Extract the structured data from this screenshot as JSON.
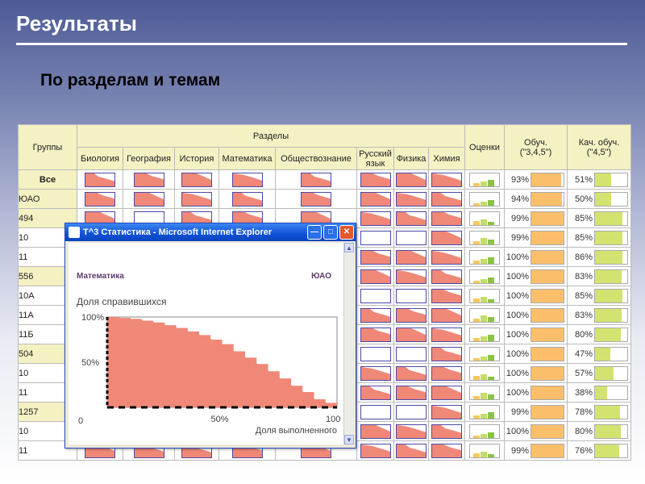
{
  "slide": {
    "title": "Результаты",
    "subtitle": "По разделам и темам"
  },
  "table": {
    "header_groups": "Группы",
    "header_sections": "Разделы",
    "header_grades": "Оценки",
    "header_obuch": "Обуч. (\"3,4,5\")",
    "header_kach": "Кач. обуч. (\"4,5\")",
    "subjects": [
      "Биология",
      "География",
      "История",
      "Математика",
      "Обществознание",
      "Русский язык",
      "Физика",
      "Химия"
    ],
    "rows": [
      {
        "group": "Все",
        "level": 0,
        "obuch": "93%",
        "obuch_value": 0.93,
        "kach": "51%",
        "kach_value": 0.51
      },
      {
        "group": "ЮАО",
        "level": 1,
        "obuch": "94%",
        "obuch_value": 0.94,
        "kach": "50%",
        "kach_value": 0.5
      },
      {
        "group": "494",
        "level": 2,
        "obuch": "99%",
        "obuch_value": 0.99,
        "kach": "85%",
        "kach_value": 0.85
      },
      {
        "group": "10",
        "level": 3,
        "obuch": "99%",
        "obuch_value": 0.99,
        "kach": "85%",
        "kach_value": 0.85
      },
      {
        "group": "11",
        "level": 3,
        "obuch": "100%",
        "obuch_value": 1.0,
        "kach": "86%",
        "kach_value": 0.86
      },
      {
        "group": "556",
        "level": 2,
        "obuch": "100%",
        "obuch_value": 1.0,
        "kach": "83%",
        "kach_value": 0.83
      },
      {
        "group": "10А",
        "level": 3,
        "obuch": "100%",
        "obuch_value": 1.0,
        "kach": "85%",
        "kach_value": 0.85
      },
      {
        "group": "11А",
        "level": 3,
        "obuch": "100%",
        "obuch_value": 1.0,
        "kach": "83%",
        "kach_value": 0.83
      },
      {
        "group": "11Б",
        "level": 3,
        "obuch": "100%",
        "obuch_value": 1.0,
        "kach": "80%",
        "kach_value": 0.8
      },
      {
        "group": "504",
        "level": 2,
        "obuch": "100%",
        "obuch_value": 1.0,
        "kach": "47%",
        "kach_value": 0.47
      },
      {
        "group": "10",
        "level": 3,
        "obuch": "100%",
        "obuch_value": 1.0,
        "kach": "57%",
        "kach_value": 0.57
      },
      {
        "group": "11",
        "level": 3,
        "obuch": "100%",
        "obuch_value": 1.0,
        "kach": "38%",
        "kach_value": 0.38
      },
      {
        "group": "1257",
        "level": 2,
        "obuch": "99%",
        "obuch_value": 0.99,
        "kach": "78%",
        "kach_value": 0.78
      },
      {
        "group": "10",
        "level": 3,
        "obuch": "100%",
        "obuch_value": 1.0,
        "kach": "80%",
        "kach_value": 0.8
      },
      {
        "group": "11",
        "level": 3,
        "obuch": "99%",
        "obuch_value": 0.99,
        "kach": "76%",
        "kach_value": 0.76
      }
    ],
    "colors": {
      "fill": "#f08878",
      "obuch": "#fbbf6c",
      "kach": "#d4e36f",
      "header": "#f4f1c3"
    }
  },
  "popup": {
    "window_title": "Т^3 Статистика - Microsoft Internet Explorer",
    "chart_subject": "Математика",
    "chart_region": "ЮАО",
    "minimize_icon": "minimize-icon",
    "maximize_icon": "maximize-icon",
    "close_icon": "close-icon"
  },
  "chart_data": {
    "type": "area",
    "ylabel": "Доля справившихся",
    "xlabel": "Доля выполненного",
    "y_ticks": [
      "100%",
      "50%",
      "0"
    ],
    "x_ticks": [
      "50%",
      "100%"
    ],
    "xlim": [
      0,
      100
    ],
    "ylim": [
      0,
      100
    ],
    "color": "#f08878",
    "x": [
      0,
      5,
      10,
      15,
      20,
      25,
      30,
      35,
      40,
      45,
      50,
      55,
      60,
      65,
      70,
      75,
      80,
      85,
      90,
      95,
      100
    ],
    "y": [
      100,
      99,
      98,
      96,
      94,
      91,
      88,
      84,
      80,
      75,
      70,
      62,
      55,
      48,
      40,
      32,
      24,
      17,
      9,
      5,
      2
    ]
  }
}
